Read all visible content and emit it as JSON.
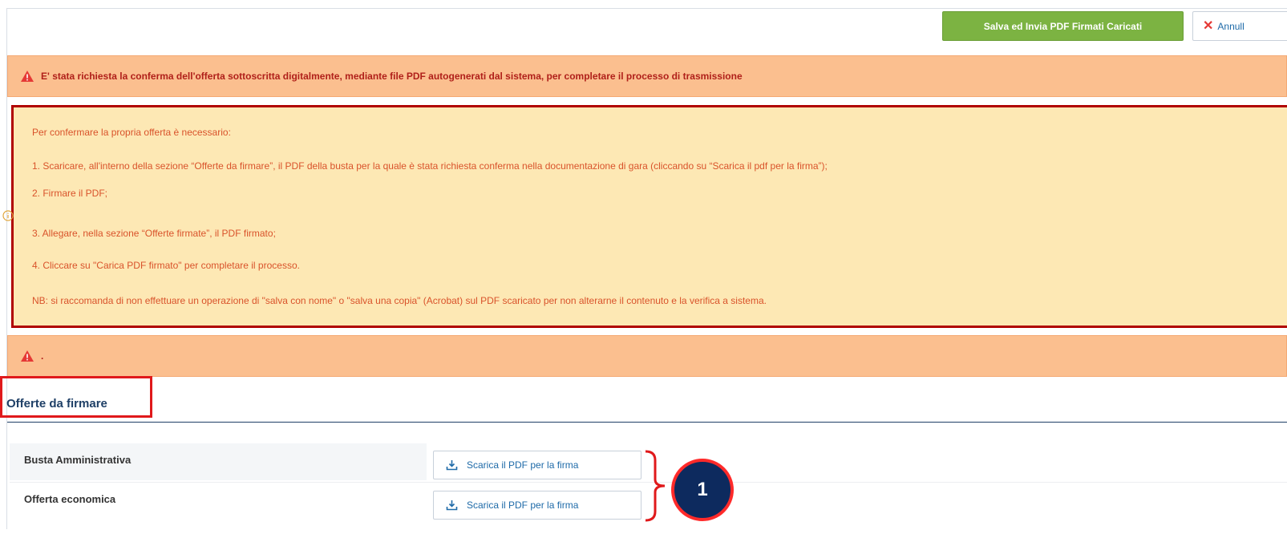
{
  "toolbar": {
    "primary_label": "Salva ed Invia PDF Firmati Caricati",
    "cancel_label": "Annull"
  },
  "alert_top": {
    "text": "E' stata richiesta la conferma dell'offerta sottoscritta digitalmente, mediante file PDF autogenerati dal sistema, per completare il processo di trasmissione"
  },
  "instructions": {
    "lines": [
      "Per confermare la propria offerta è necessario:",
      "1. Scaricare, all'interno della sezione “Offerte da firmare”, il PDF della busta per la quale è stata richiesta conferma nella documentazione di gara (cliccando su “Scarica il pdf per la firma”);",
      "2. Firmare il PDF;",
      "3. Allegare, nella sezione “Offerte firmate”, il PDF firmato;",
      "4. Cliccare su \"Carica PDF firmato\" per completare il processo.",
      "NB: si raccomanda di non effettuare un operazione di \"salva con nome\" o \"salva una copia\" (Acrobat) sul PDF scaricato per non alterarne il contenuto e la verifica a sistema."
    ]
  },
  "alert_bottom": {
    "text": "."
  },
  "section": {
    "title": "Offerte da firmare"
  },
  "rows": [
    {
      "label": "Busta Amministrativa",
      "button": "Scarica il PDF per la firma"
    },
    {
      "label": "Offerta economica",
      "button": "Scarica il PDF per la firma"
    }
  ],
  "callout": {
    "number": "1"
  },
  "colors": {
    "primary_button": "#7cb342",
    "alert_bg": "#fbbf8f",
    "alert_text": "#b0201a",
    "info_bg": "#fde8b4",
    "info_text": "#d9532b",
    "highlight_border": "#b00000",
    "link": "#1e6aa8",
    "callout_bg": "#0d2a5e"
  },
  "icons": {
    "alert": "warning-triangle-icon",
    "info": "info-circle-icon",
    "cancel": "close-icon",
    "download": "download-icon"
  }
}
